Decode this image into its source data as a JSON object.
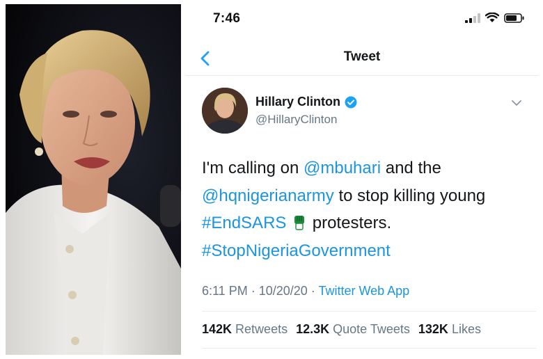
{
  "status_bar": {
    "time": "7:46"
  },
  "nav": {
    "title": "Tweet"
  },
  "author": {
    "name": "Hillary Clinton",
    "handle": "@HillaryClinton"
  },
  "tweet": {
    "text_before": "I'm calling on ",
    "mention1": "@mbuhari",
    "text_mid1": " and the ",
    "mention2": "@hqnigerianarmy",
    "text_mid2": " to stop killing young ",
    "hashtag1": "#EndSARS",
    "text_mid3": " protesters.",
    "hashtag2": "#StopNigeriaGovernment"
  },
  "meta": {
    "time": "6:11 PM",
    "separator": " · ",
    "date": "10/20/20",
    "client": "Twitter Web App"
  },
  "stats": {
    "retweets_count": "142K",
    "retweets_label": "Retweets",
    "quotes_count": "12.3K",
    "quotes_label": "Quote Tweets",
    "likes_count": "132K",
    "likes_label": "Likes"
  },
  "colors": {
    "link": "#1b95e0",
    "text": "#14171a",
    "muted": "#657786",
    "verified": "#1da1f2"
  },
  "icons": [
    "back-chevron-icon",
    "verified-badge-icon",
    "chevron-down-icon",
    "raised-fist-emoji",
    "signal-icon",
    "wifi-icon",
    "battery-icon"
  ]
}
